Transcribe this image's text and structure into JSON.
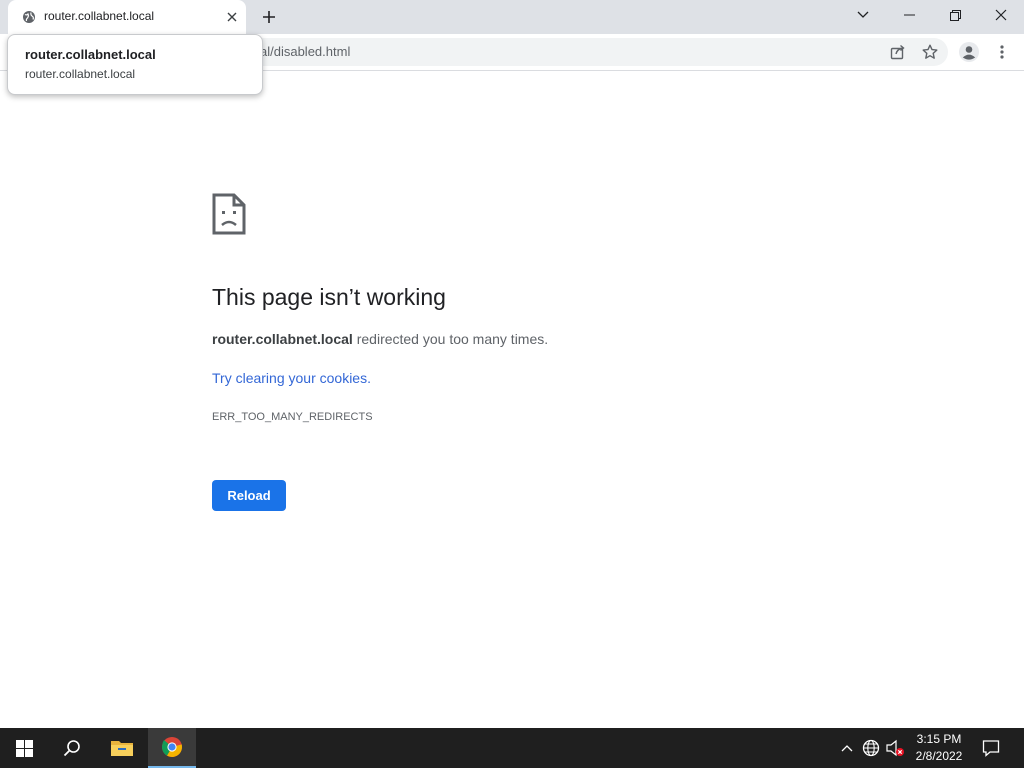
{
  "tab": {
    "title": "router.collabnet.local",
    "favicon": "globe-icon",
    "close": "close-icon"
  },
  "tabstrip": {
    "new_tab": "plus-icon",
    "search_tabs": "chevron-down-icon",
    "minimize": "minimize-icon",
    "restore": "restore-icon",
    "close": "close-icon"
  },
  "toolbar": {
    "url_visible": "al/disabled.html",
    "share": "share-icon",
    "bookmark": "star-icon",
    "profile": "profile-icon",
    "menu": "more-vert-icon"
  },
  "hovercard": {
    "title": "router.collabnet.local",
    "url": "router.collabnet.local"
  },
  "error": {
    "icon": "sad-page-icon",
    "heading": "This page isn’t working",
    "host": "router.collabnet.local",
    "message": " redirected you too many times.",
    "link": "Try clearing your cookies.",
    "code": "ERR_TOO_MANY_REDIRECTS",
    "reload_label": "Reload"
  },
  "taskbar": {
    "start": "windows-icon",
    "search": "search-icon",
    "explorer": "folder-icon",
    "chrome": "chrome-icon",
    "tray": [
      "chevron-up-icon",
      "network-icon",
      "volume-muted-icon"
    ],
    "time": "3:15 PM",
    "date": "2/8/2022",
    "notifications": "notification-icon"
  },
  "colors": {
    "accent": "#1a73e8",
    "link": "#3367d6",
    "tabstrip_bg": "#dee1e6",
    "taskbar_bg": "#1f1f1f"
  }
}
